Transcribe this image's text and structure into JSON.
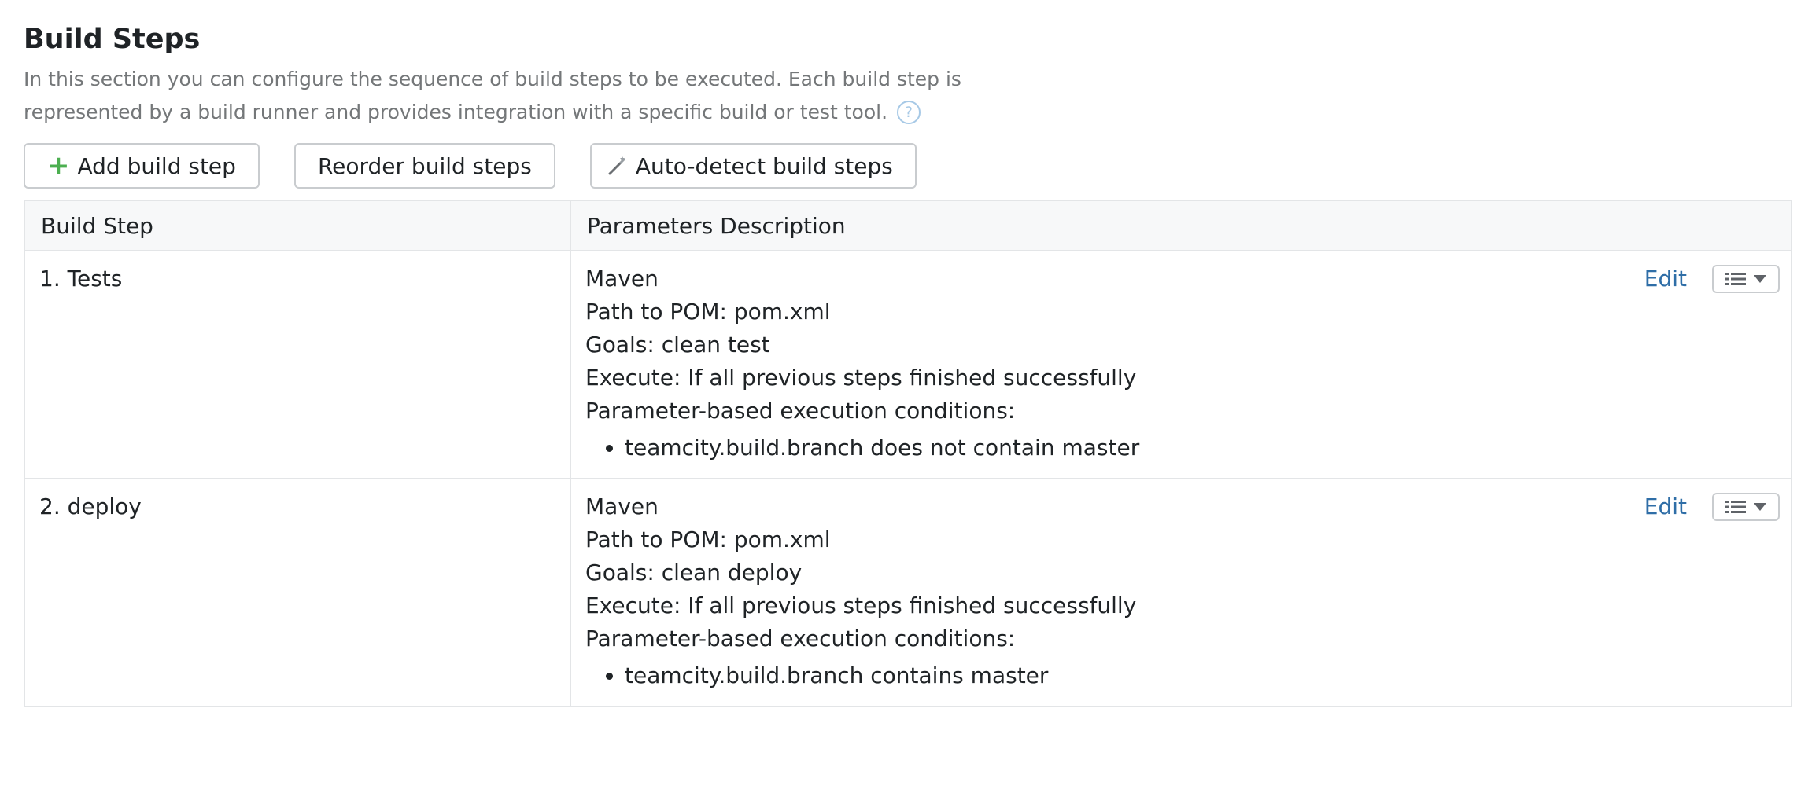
{
  "header": {
    "title": "Build Steps",
    "description": "In this section you can configure the sequence of build steps to be executed. Each build step is represented by a build runner and provides integration with a specific build or test tool.",
    "help_icon": "?"
  },
  "toolbar": {
    "add_label": "Add build step",
    "reorder_label": "Reorder build steps",
    "autodetect_label": "Auto-detect build steps"
  },
  "table": {
    "columns": [
      "Build Step",
      "Parameters Description"
    ],
    "rows": [
      {
        "name": "1. Tests",
        "runner": "Maven",
        "pom": "Path to POM: pom.xml",
        "goals": "Goals: clean test",
        "execute": "Execute: If all previous steps finished successfully",
        "conditions_label": "Parameter-based execution conditions:",
        "conditions": [
          "teamcity.build.branch does not contain master"
        ],
        "edit_label": "Edit"
      },
      {
        "name": "2. deploy",
        "runner": "Maven",
        "pom": "Path to POM: pom.xml",
        "goals": "Goals: clean deploy",
        "execute": "Execute: If all previous steps finished successfully",
        "conditions_label": "Parameter-based execution conditions:",
        "conditions": [
          "teamcity.build.branch contains master"
        ],
        "edit_label": "Edit"
      }
    ]
  },
  "icons": {
    "add": "plus-icon",
    "autodetect": "magic-wand-icon",
    "help": "help-icon",
    "row_menu": "list-icon",
    "row_menu_arrow": "chevron-down-icon"
  },
  "colors": {
    "link": "#2f6ea7",
    "plus": "#4caf50",
    "help": "#a7c9e6"
  }
}
